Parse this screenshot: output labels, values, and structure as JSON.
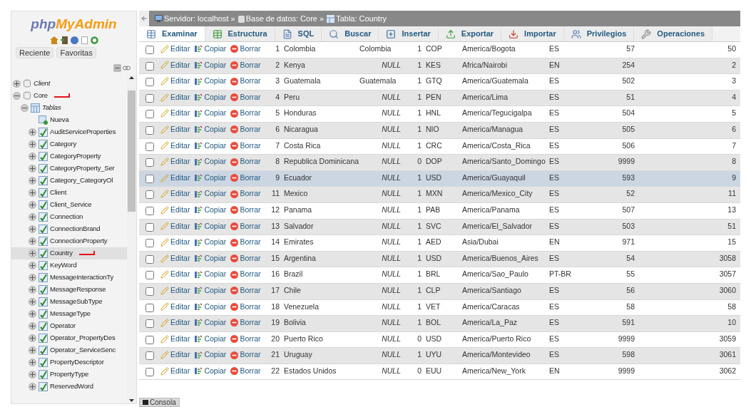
{
  "logo": {
    "part_1": "php",
    "part_2": "MyAdmin"
  },
  "nav_tabs": [
    {
      "label": "Reciente"
    },
    {
      "label": "Favoritas"
    }
  ],
  "tree": [
    {
      "label": "Client",
      "italic": true,
      "expanded": false,
      "selected": false,
      "marked": false,
      "kind": "database"
    },
    {
      "label": "Core",
      "italic": false,
      "expanded": true,
      "selected": false,
      "marked": true,
      "kind": "database",
      "children": [
        {
          "label": "Tablas",
          "italic": true,
          "expanded": true,
          "selected": false,
          "marked": false,
          "kind": "group",
          "children": [
            {
              "label": "Nueva",
              "selected": false,
              "marked": false,
              "kind": "new"
            },
            {
              "label": "AuditServiceProperties",
              "selected": false,
              "marked": false,
              "kind": "table"
            },
            {
              "label": "Category",
              "selected": false,
              "marked": false,
              "kind": "table"
            },
            {
              "label": "CategoryProperty",
              "selected": false,
              "marked": false,
              "kind": "table"
            },
            {
              "label": "CategoryProperty_Ser",
              "selected": false,
              "marked": false,
              "kind": "table"
            },
            {
              "label": "Category_CategoryOl",
              "selected": false,
              "marked": false,
              "kind": "table"
            },
            {
              "label": "Client",
              "selected": false,
              "marked": false,
              "kind": "table"
            },
            {
              "label": "Client_Service",
              "selected": false,
              "marked": false,
              "kind": "table"
            },
            {
              "label": "Connection",
              "selected": false,
              "marked": false,
              "kind": "table"
            },
            {
              "label": "ConnectionBrand",
              "selected": false,
              "marked": false,
              "kind": "table"
            },
            {
              "label": "ConnectionProperty",
              "selected": false,
              "marked": false,
              "kind": "table"
            },
            {
              "label": "Country",
              "selected": true,
              "marked": true,
              "kind": "table"
            },
            {
              "label": "KeyWord",
              "selected": false,
              "marked": false,
              "kind": "table"
            },
            {
              "label": "MessageInteractionTy",
              "selected": false,
              "marked": false,
              "kind": "table"
            },
            {
              "label": "MessageResponse",
              "selected": false,
              "marked": false,
              "kind": "table"
            },
            {
              "label": "MessageSubType",
              "selected": false,
              "marked": false,
              "kind": "table"
            },
            {
              "label": "MessageType",
              "selected": false,
              "marked": false,
              "kind": "table"
            },
            {
              "label": "Operator",
              "selected": false,
              "marked": false,
              "kind": "table"
            },
            {
              "label": "Operator_PropertyDes",
              "selected": false,
              "marked": false,
              "kind": "table"
            },
            {
              "label": "Operator_ServiceSenc",
              "selected": false,
              "marked": false,
              "kind": "table"
            },
            {
              "label": "PropertyDescriptor",
              "selected": false,
              "marked": false,
              "kind": "table"
            },
            {
              "label": "PropertyType",
              "selected": false,
              "marked": false,
              "kind": "table"
            },
            {
              "label": "ReservedWord",
              "selected": false,
              "marked": false,
              "kind": "table"
            }
          ]
        }
      ]
    }
  ],
  "breadcrumb": [
    {
      "text": "Servidor: localhost »",
      "kind": "server"
    },
    {
      "text": "Base de datos: Core »",
      "kind": "database"
    },
    {
      "text": "Tabla: Country",
      "kind": "table"
    }
  ],
  "tabs": [
    {
      "label": "Examinar",
      "selected": true,
      "kind": "browse"
    },
    {
      "label": "Estructura",
      "selected": false,
      "kind": "structure"
    },
    {
      "label": "SQL",
      "selected": false,
      "kind": "sql"
    },
    {
      "label": "Buscar",
      "selected": false,
      "kind": "search"
    },
    {
      "label": "Insertar",
      "selected": false,
      "kind": "insert"
    },
    {
      "label": "Exportar",
      "selected": false,
      "kind": "export"
    },
    {
      "label": "Importar",
      "selected": false,
      "kind": "import"
    },
    {
      "label": "Privilegios",
      "selected": false,
      "kind": "privileges"
    },
    {
      "label": "Operaciones",
      "selected": false,
      "kind": "operations"
    }
  ],
  "rows": [
    {
      "selected": false,
      "checked": false,
      "actions": [
        "Editar",
        "Copiar",
        "Borrar"
      ],
      "id": "1",
      "name": "Colombia",
      "column_5": {
        "text": "Colombia",
        "is_null": false
      },
      "column_6": "1",
      "currency": "COP",
      "timezone": "America/Bogota",
      "language": "ES",
      "column_10": "57",
      "column_11": "50"
    },
    {
      "selected": false,
      "checked": false,
      "actions": [
        "Editar",
        "Copiar",
        "Borrar"
      ],
      "id": "2",
      "name": "Kenya",
      "column_5": {
        "text": "NULL",
        "is_null": true
      },
      "column_6": "1",
      "currency": "KES",
      "timezone": "Africa/Nairobi",
      "language": "EN",
      "column_10": "254",
      "column_11": "2"
    },
    {
      "selected": false,
      "checked": false,
      "actions": [
        "Editar",
        "Copiar",
        "Borrar"
      ],
      "id": "3",
      "name": "Guatemala",
      "column_5": {
        "text": "Guatemala",
        "is_null": false
      },
      "column_6": "1",
      "currency": "GTQ",
      "timezone": "America/Guatemala",
      "language": "ES",
      "column_10": "502",
      "column_11": "3"
    },
    {
      "selected": false,
      "checked": false,
      "actions": [
        "Editar",
        "Copiar",
        "Borrar"
      ],
      "id": "4",
      "name": "Peru",
      "column_5": {
        "text": "NULL",
        "is_null": true
      },
      "column_6": "1",
      "currency": "PEN",
      "timezone": "America/Lima",
      "language": "ES",
      "column_10": "51",
      "column_11": "4"
    },
    {
      "selected": false,
      "checked": false,
      "actions": [
        "Editar",
        "Copiar",
        "Borrar"
      ],
      "id": "5",
      "name": "Honduras",
      "column_5": {
        "text": "NULL",
        "is_null": true
      },
      "column_6": "1",
      "currency": "HNL",
      "timezone": "America/Tegucigalpa",
      "language": "ES",
      "column_10": "504",
      "column_11": "5"
    },
    {
      "selected": false,
      "checked": false,
      "actions": [
        "Editar",
        "Copiar",
        "Borrar"
      ],
      "id": "6",
      "name": "Nicaragua",
      "column_5": {
        "text": "NULL",
        "is_null": true
      },
      "column_6": "1",
      "currency": "NIO",
      "timezone": "America/Managua",
      "language": "ES",
      "column_10": "505",
      "column_11": "6"
    },
    {
      "selected": false,
      "checked": false,
      "actions": [
        "Editar",
        "Copiar",
        "Borrar"
      ],
      "id": "7",
      "name": "Costa Rica",
      "column_5": {
        "text": "NULL",
        "is_null": true
      },
      "column_6": "1",
      "currency": "CRC",
      "timezone": "America/Costa_Rica",
      "language": "ES",
      "column_10": "506",
      "column_11": "7"
    },
    {
      "selected": false,
      "checked": false,
      "actions": [
        "Editar",
        "Copiar",
        "Borrar"
      ],
      "id": "8",
      "name": "Republica Dominicana",
      "column_5": {
        "text": "NULL",
        "is_null": true
      },
      "column_6": "0",
      "currency": "DOP",
      "timezone": "America/Santo_Domingo",
      "language": "ES",
      "column_10": "9999",
      "column_11": "8"
    },
    {
      "selected": true,
      "checked": false,
      "actions": [
        "Editar",
        "Copiar",
        "Borrar"
      ],
      "id": "9",
      "name": "Ecuador",
      "column_5": {
        "text": "NULL",
        "is_null": true
      },
      "column_6": "1",
      "currency": "USD",
      "timezone": "America/Guayaquil",
      "language": "ES",
      "column_10": "593",
      "column_11": "9"
    },
    {
      "selected": false,
      "checked": false,
      "actions": [
        "Editar",
        "Copiar",
        "Borrar"
      ],
      "id": "11",
      "name": "Mexico",
      "column_5": {
        "text": "NULL",
        "is_null": true
      },
      "column_6": "1",
      "currency": "MXN",
      "timezone": "America/Mexico_City",
      "language": "ES",
      "column_10": "52",
      "column_11": "11"
    },
    {
      "selected": false,
      "checked": false,
      "actions": [
        "Editar",
        "Copiar",
        "Borrar"
      ],
      "id": "12",
      "name": "Panama",
      "column_5": {
        "text": "NULL",
        "is_null": true
      },
      "column_6": "1",
      "currency": "PAB",
      "timezone": "America/Panama",
      "language": "ES",
      "column_10": "507",
      "column_11": "13"
    },
    {
      "selected": false,
      "checked": false,
      "actions": [
        "Editar",
        "Copiar",
        "Borrar"
      ],
      "id": "13",
      "name": "Salvador",
      "column_5": {
        "text": "NULL",
        "is_null": true
      },
      "column_6": "1",
      "currency": "SVC",
      "timezone": "America/El_Salvador",
      "language": "ES",
      "column_10": "503",
      "column_11": "51"
    },
    {
      "selected": false,
      "checked": false,
      "actions": [
        "Editar",
        "Copiar",
        "Borrar"
      ],
      "id": "14",
      "name": "Emirates",
      "column_5": {
        "text": "NULL",
        "is_null": true
      },
      "column_6": "1",
      "currency": "AED",
      "timezone": "Asia/Dubai",
      "language": "EN",
      "column_10": "971",
      "column_11": "15"
    },
    {
      "selected": false,
      "checked": false,
      "actions": [
        "Editar",
        "Copiar",
        "Borrar"
      ],
      "id": "15",
      "name": "Argentina",
      "column_5": {
        "text": "NULL",
        "is_null": true
      },
      "column_6": "1",
      "currency": "USD",
      "timezone": "America/Buenos_Aires",
      "language": "ES",
      "column_10": "54",
      "column_11": "3058"
    },
    {
      "selected": false,
      "checked": false,
      "actions": [
        "Editar",
        "Copiar",
        "Borrar"
      ],
      "id": "16",
      "name": "Brazil",
      "column_5": {
        "text": "NULL",
        "is_null": true
      },
      "column_6": "1",
      "currency": "BRL",
      "timezone": "America/Sao_Paulo",
      "language": "PT-BR",
      "column_10": "55",
      "column_11": "3057"
    },
    {
      "selected": false,
      "checked": false,
      "actions": [
        "Editar",
        "Copiar",
        "Borrar"
      ],
      "id": "17",
      "name": "Chile",
      "column_5": {
        "text": "NULL",
        "is_null": true
      },
      "column_6": "1",
      "currency": "CLP",
      "timezone": "America/Santiago",
      "language": "ES",
      "column_10": "56",
      "column_11": "3060"
    },
    {
      "selected": false,
      "checked": false,
      "actions": [
        "Editar",
        "Copiar",
        "Borrar"
      ],
      "id": "18",
      "name": "Venezuela",
      "column_5": {
        "text": "NULL",
        "is_null": true
      },
      "column_6": "1",
      "currency": "VET",
      "timezone": "America/Caracas",
      "language": "ES",
      "column_10": "58",
      "column_11": "58"
    },
    {
      "selected": false,
      "checked": false,
      "actions": [
        "Editar",
        "Copiar",
        "Borrar"
      ],
      "id": "19",
      "name": "Bolivia",
      "column_5": {
        "text": "NULL",
        "is_null": true
      },
      "column_6": "1",
      "currency": "BOL",
      "timezone": "America/La_Paz",
      "language": "ES",
      "column_10": "591",
      "column_11": "10"
    },
    {
      "selected": false,
      "checked": false,
      "actions": [
        "Editar",
        "Copiar",
        "Borrar"
      ],
      "id": "20",
      "name": "Puerto Rico",
      "column_5": {
        "text": "NULL",
        "is_null": true
      },
      "column_6": "0",
      "currency": "USD",
      "timezone": "America/Puerto Rico",
      "language": "ES",
      "column_10": "9999",
      "column_11": "3059"
    },
    {
      "selected": false,
      "checked": false,
      "actions": [
        "Editar",
        "Copiar",
        "Borrar"
      ],
      "id": "21",
      "name": "Uruguay",
      "column_5": {
        "text": "NULL",
        "is_null": true
      },
      "column_6": "1",
      "currency": "UYU",
      "timezone": "America/Montevideo",
      "language": "ES",
      "column_10": "598",
      "column_11": "3061"
    },
    {
      "selected": false,
      "checked": false,
      "actions": [
        "Editar",
        "Copiar",
        "Borrar"
      ],
      "id": "22",
      "name": "Estados Unidos",
      "column_5": {
        "text": "NULL",
        "is_null": true
      },
      "column_6": "0",
      "currency": "EUU",
      "timezone": "America/New_York",
      "language": "EN",
      "column_10": "9999",
      "column_11": "3062"
    }
  ],
  "console": {
    "label": "Consola"
  }
}
